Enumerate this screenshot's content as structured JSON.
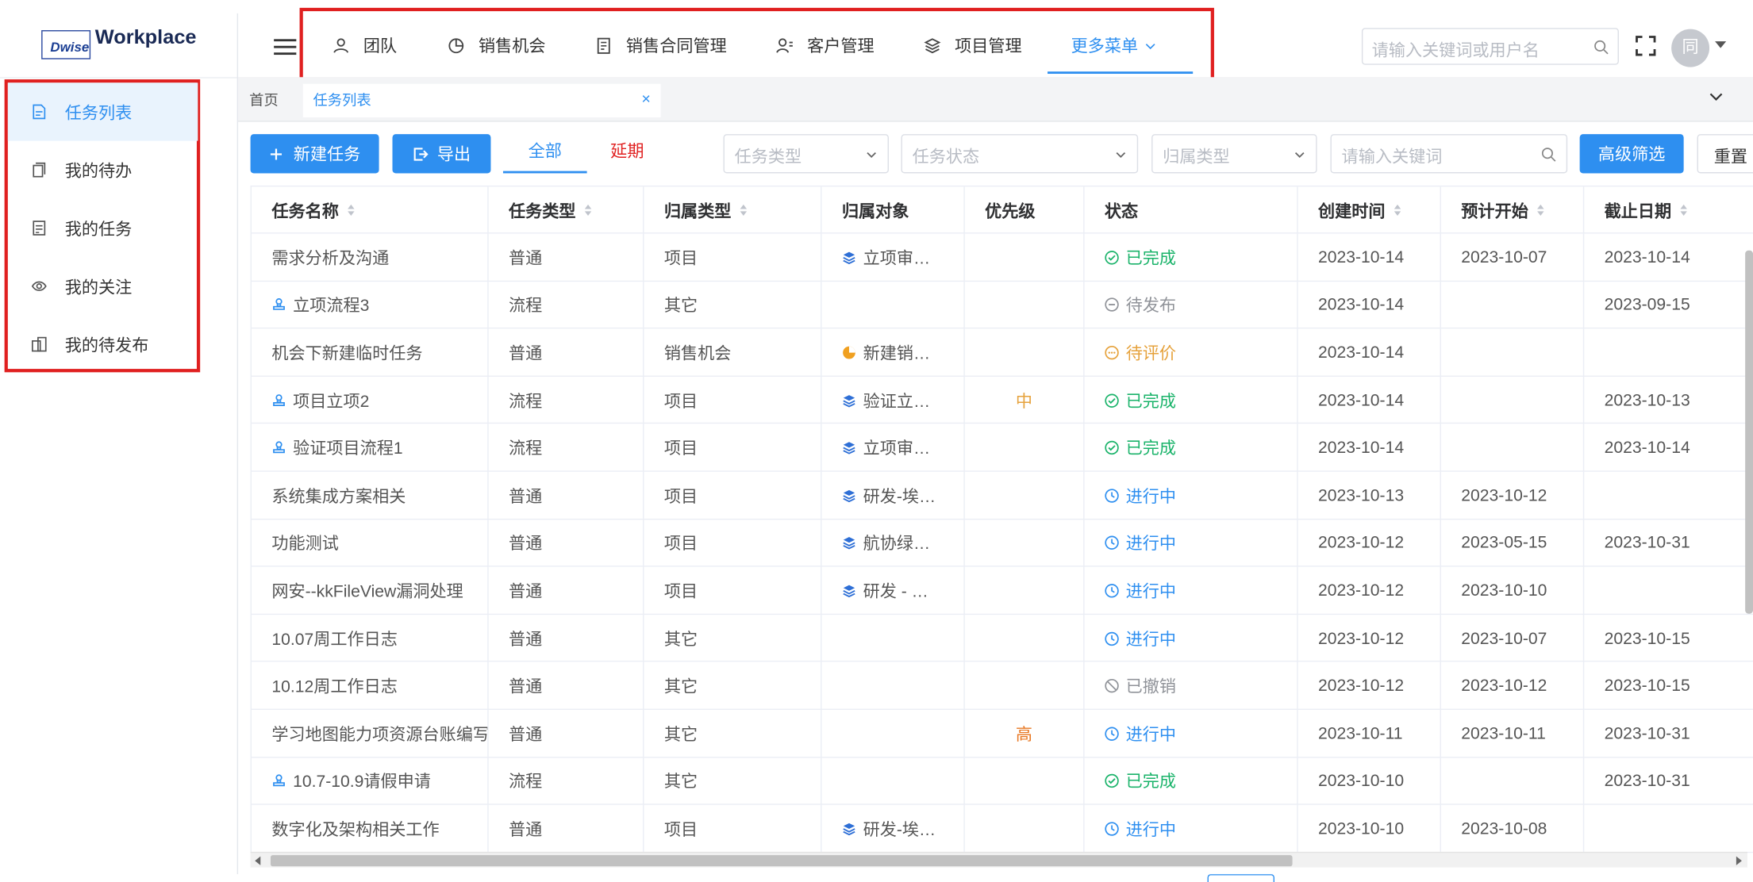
{
  "app": {
    "brand_small": "Dwise",
    "brand_name": "Workplace"
  },
  "nav": {
    "items": [
      {
        "label": "团队",
        "icon": "team-icon"
      },
      {
        "label": "销售机会",
        "icon": "pie-chart-icon"
      },
      {
        "label": "销售合同管理",
        "icon": "contract-icon"
      },
      {
        "label": "客户管理",
        "icon": "customer-icon"
      },
      {
        "label": "项目管理",
        "icon": "layers-icon"
      },
      {
        "label": "更多菜单",
        "icon": "chevron-down-icon"
      }
    ],
    "active_index": 5
  },
  "header": {
    "search_placeholder": "请输入关键词或用户名",
    "avatar_text": "同"
  },
  "sidebar": {
    "items": [
      {
        "label": "任务列表",
        "icon": "document-icon"
      },
      {
        "label": "我的待办",
        "icon": "clipboard-icon"
      },
      {
        "label": "我的任务",
        "icon": "task-icon"
      },
      {
        "label": "我的关注",
        "icon": "eye-icon"
      },
      {
        "label": "我的待发布",
        "icon": "publish-icon"
      }
    ],
    "active_index": 0
  },
  "tabs": {
    "home": "首页",
    "active": "任务列表",
    "close": "×"
  },
  "toolbar": {
    "new_task": "新建任务",
    "export": "导出",
    "seg_all": "全部",
    "seg_delay": "延期",
    "filter_type": "任务类型",
    "filter_status": "任务状态",
    "filter_owner_type": "归属类型",
    "keyword_placeholder": "请输入关键词",
    "advanced": "高级筛选",
    "reset": "重置"
  },
  "colors": {
    "accent": "#2e8ff0",
    "highlight_box": "#e02020",
    "done": "#1ab36a",
    "review": "#e6a23c",
    "high": "#e87722"
  },
  "table": {
    "columns": [
      "任务名称",
      "任务类型",
      "归属类型",
      "归属对象",
      "优先级",
      "状态",
      "创建时间",
      "预计开始",
      "截止日期"
    ],
    "rows": [
      {
        "name": "需求分析及沟通",
        "name_icon": "",
        "type": "普通",
        "owner_type": "项目",
        "owner": "立项审…",
        "owner_icon": "layers-icon",
        "priority": "",
        "status": "已完成",
        "status_kind": "done",
        "created": "2023-10-14",
        "start": "2023-10-07",
        "due": "2023-10-14"
      },
      {
        "name": "立项流程3",
        "name_icon": "stamp-icon",
        "type": "流程",
        "owner_type": "其它",
        "owner": "",
        "owner_icon": "",
        "priority": "",
        "status": "待发布",
        "status_kind": "pending",
        "created": "2023-10-14",
        "start": "",
        "due": "2023-09-15"
      },
      {
        "name": "机会下新建临时任务",
        "name_icon": "",
        "type": "普通",
        "owner_type": "销售机会",
        "owner": "新建销…",
        "owner_icon": "pie-chart-icon",
        "priority": "",
        "status": "待评价",
        "status_kind": "review",
        "created": "2023-10-14",
        "start": "",
        "due": ""
      },
      {
        "name": "项目立项2",
        "name_icon": "stamp-icon",
        "type": "流程",
        "owner_type": "项目",
        "owner": "验证立…",
        "owner_icon": "layers-icon",
        "priority": "中",
        "priority_kind": "mid",
        "status": "已完成",
        "status_kind": "done",
        "created": "2023-10-14",
        "start": "",
        "due": "2023-10-13"
      },
      {
        "name": "验证项目流程1",
        "name_icon": "stamp-icon",
        "type": "流程",
        "owner_type": "项目",
        "owner": "立项审…",
        "owner_icon": "layers-icon",
        "priority": "",
        "status": "已完成",
        "status_kind": "done",
        "created": "2023-10-14",
        "start": "",
        "due": "2023-10-14"
      },
      {
        "name": "系统集成方案相关",
        "name_icon": "",
        "type": "普通",
        "owner_type": "项目",
        "owner": "研发-埃…",
        "owner_icon": "layers-icon",
        "priority": "",
        "status": "进行中",
        "status_kind": "prog",
        "created": "2023-10-13",
        "start": "2023-10-12",
        "due": ""
      },
      {
        "name": "功能测试",
        "name_icon": "",
        "type": "普通",
        "owner_type": "项目",
        "owner": "航协绿…",
        "owner_icon": "layers-icon",
        "priority": "",
        "status": "进行中",
        "status_kind": "prog",
        "created": "2023-10-12",
        "start": "2023-05-15",
        "due": "2023-10-31"
      },
      {
        "name": "网安--kkFileView漏洞处理",
        "name_icon": "",
        "type": "普通",
        "owner_type": "项目",
        "owner": "研发 - …",
        "owner_icon": "layers-icon",
        "priority": "",
        "status": "进行中",
        "status_kind": "prog",
        "created": "2023-10-12",
        "start": "2023-10-10",
        "due": ""
      },
      {
        "name": "10.07周工作日志",
        "name_icon": "",
        "type": "普通",
        "owner_type": "其它",
        "owner": "",
        "owner_icon": "",
        "priority": "",
        "status": "进行中",
        "status_kind": "prog",
        "created": "2023-10-12",
        "start": "2023-10-07",
        "due": "2023-10-15"
      },
      {
        "name": "10.12周工作日志",
        "name_icon": "",
        "type": "普通",
        "owner_type": "其它",
        "owner": "",
        "owner_icon": "",
        "priority": "",
        "status": "已撤销",
        "status_kind": "cancel",
        "created": "2023-10-12",
        "start": "2023-10-12",
        "due": "2023-10-15"
      },
      {
        "name": "学习地图能力项资源台账编写",
        "name_icon": "",
        "type": "普通",
        "owner_type": "其它",
        "owner": "",
        "owner_icon": "",
        "priority": "高",
        "priority_kind": "high",
        "status": "进行中",
        "status_kind": "prog",
        "created": "2023-10-11",
        "start": "2023-10-11",
        "due": "2023-10-31"
      },
      {
        "name": "10.7-10.9请假申请",
        "name_icon": "stamp-icon",
        "type": "流程",
        "owner_type": "其它",
        "owner": "",
        "owner_icon": "",
        "priority": "",
        "status": "已完成",
        "status_kind": "done",
        "created": "2023-10-10",
        "start": "",
        "due": "2023-10-31"
      },
      {
        "name": "数字化及架构相关工作",
        "name_icon": "",
        "type": "普通",
        "owner_type": "项目",
        "owner": "研发-埃…",
        "owner_icon": "layers-icon",
        "priority": "",
        "status": "进行中",
        "status_kind": "prog",
        "created": "2023-10-10",
        "start": "2023-10-08",
        "due": ""
      }
    ]
  }
}
